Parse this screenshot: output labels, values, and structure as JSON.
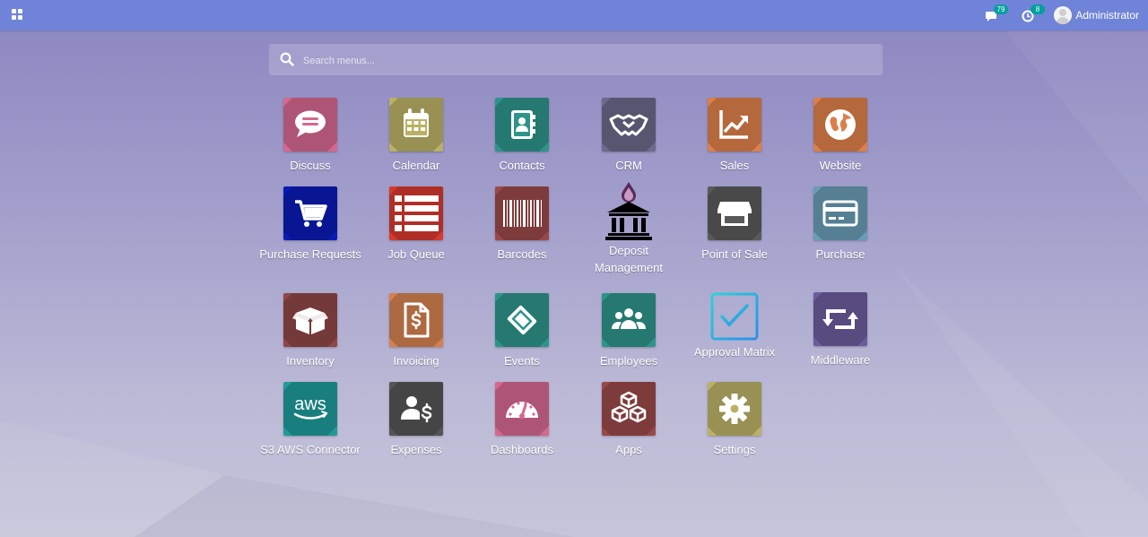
{
  "topbar": {
    "messages_count": "79",
    "activities_count": "8",
    "user_name": "Administrator"
  },
  "search": {
    "placeholder": "Search menus..."
  },
  "apps": {
    "discuss": "Discuss",
    "calendar": "Calendar",
    "contacts": "Contacts",
    "crm": "CRM",
    "sales": "Sales",
    "website": "Website",
    "purchase_requests": "Purchase Requests",
    "job_queue": "Job Queue",
    "barcodes": "Barcodes",
    "deposit_management_line1": "Deposit",
    "deposit_management_line2": "Management",
    "point_of_sale": "Point of Sale",
    "purchase": "Purchase",
    "inventory": "Inventory",
    "invoicing": "Invoicing",
    "events": "Events",
    "employees": "Employees",
    "approval_matrix": "Approval Matrix",
    "middleware": "Middleware",
    "s3_aws_connector": "S3 AWS Connector",
    "expenses": "Expenses",
    "dashboards": "Dashboards",
    "apps_label": "Apps",
    "settings": "Settings",
    "aws_logo_text": "aws"
  },
  "colors": {
    "topbar": "#6f84d8",
    "badge": "#00a09d",
    "discuss": "#d5688f",
    "calendar": "#bbb166",
    "contacts": "#2e948a",
    "crm": "#6a6a8a",
    "sales": "#dc7f4a",
    "website": "#dc7f4a",
    "purchase_requests": "#0a1bb5",
    "job_queue": "#d63a2f",
    "barcodes": "#9a4848",
    "point_of_sale": "#595959",
    "purchase": "#6a9cb5",
    "inventory": "#8e4646",
    "invoicing": "#d4804f",
    "events": "#2e948a",
    "employees": "#2e948a",
    "approval_matrix": "#31b6ea",
    "middleware": "#6b5c9d",
    "s3_aws_connector": "#1f9a9a",
    "expenses": "#555555",
    "dashboards": "#d5688f",
    "apps": "#9a4848",
    "settings": "#bbb166"
  }
}
